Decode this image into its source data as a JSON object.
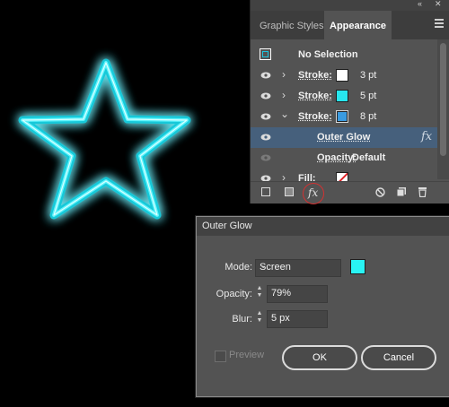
{
  "panel": {
    "tabs": [
      "Graphic Styles",
      "Appearance"
    ],
    "header": "No Selection",
    "rows": [
      {
        "label": "Stroke:",
        "value": "3 pt",
        "swatch": "#ffffff",
        "expanded": false
      },
      {
        "label": "Stroke:",
        "value": "5 pt",
        "swatch": "#27e6ee",
        "expanded": false
      },
      {
        "label": "Stroke:",
        "value": "8 pt",
        "swatch": "#3a9be0",
        "expanded": true
      },
      {
        "label": "Outer Glow",
        "fx": "fx"
      },
      {
        "label": "Opacity:",
        "value": "Default"
      },
      {
        "label": "Fill:",
        "swatch": "none"
      }
    ]
  },
  "dialog": {
    "title": "Outer Glow",
    "mode_label": "Mode:",
    "mode_value": "Screen",
    "glow_color": "#29f4f4",
    "opacity_label": "Opacity:",
    "opacity_value": "79%",
    "blur_label": "Blur:",
    "blur_value": "5 px",
    "preview_label": "Preview",
    "ok_label": "OK",
    "cancel_label": "Cancel"
  },
  "colors": {
    "neon": "#19e3f0",
    "panel_bg": "#535353",
    "selection": "#46607c"
  }
}
